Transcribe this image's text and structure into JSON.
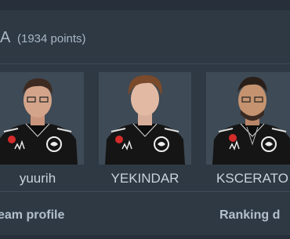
{
  "team": {
    "name": "A",
    "points": "(1934 points)"
  },
  "players": [
    {
      "name": "yuurih"
    },
    {
      "name": "YEKINDAR"
    },
    {
      "name": "KSCERATO"
    }
  ],
  "footer": {
    "team_profile": "eam profile",
    "ranking": "Ranking d"
  },
  "colors": {
    "background": "#27303a",
    "card": "#2e3944",
    "photo_bg": "#3e4a55",
    "jersey": "#151515",
    "text": "#c9d3dd"
  },
  "icons": [
    "furia-panther-logo-icon",
    "adidas-logo-icon",
    "redbull-logo-icon"
  ]
}
